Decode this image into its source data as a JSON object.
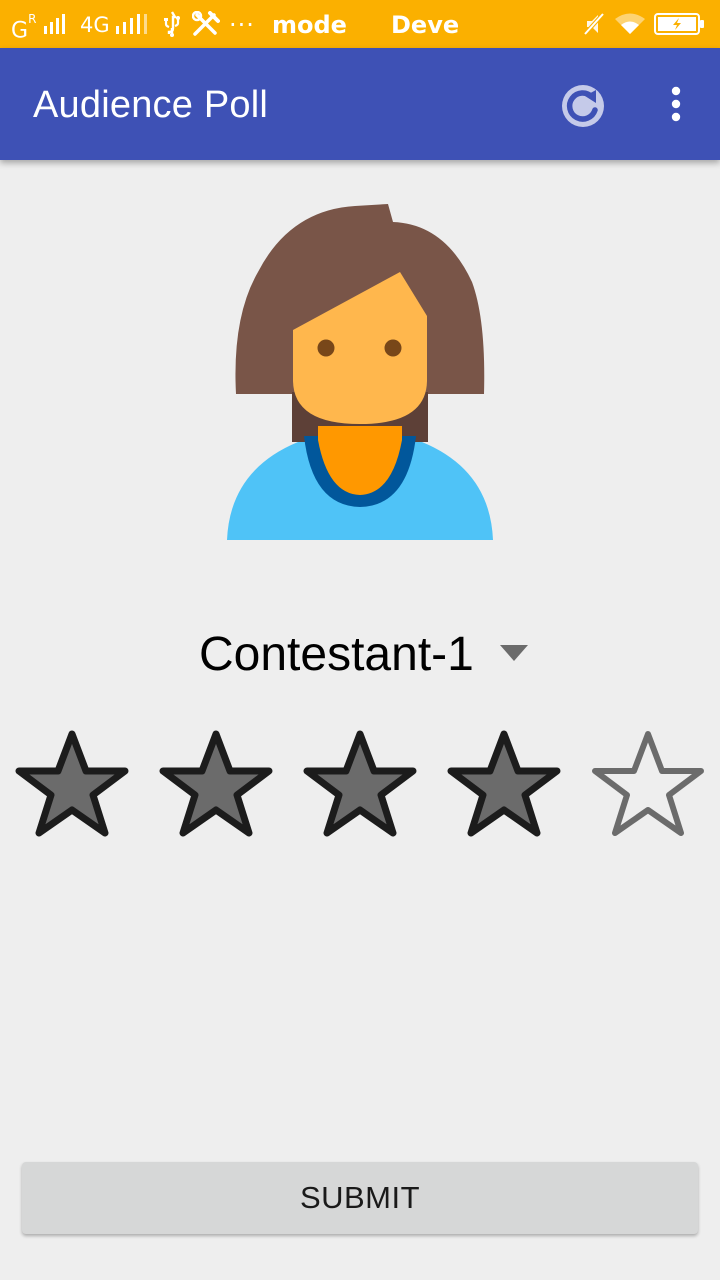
{
  "status_bar": {
    "carrier_left": "G",
    "carrier_sup": "R",
    "network": "4G",
    "dots": "···",
    "text_mode": "mode",
    "text_deve": "Deve",
    "icons": [
      "signal-icon",
      "signal-icon",
      "usb-icon",
      "tools-icon",
      "more-notifications-icon",
      "mute-icon",
      "wifi-icon",
      "battery-charging-icon"
    ]
  },
  "app_bar": {
    "title": "Audience Poll",
    "actions": [
      {
        "icon": "refresh-icon"
      },
      {
        "icon": "overflow-menu-icon"
      }
    ],
    "background": "#3e51b5"
  },
  "avatar": {
    "icon": "woman-avatar-icon"
  },
  "spinner": {
    "selected": "Contestant-1",
    "icon": "dropdown-arrow-icon"
  },
  "rating": {
    "value": 4,
    "max": 5,
    "filled_color": "#6b6b6b",
    "empty_color": "#6b6b6b"
  },
  "submit": {
    "label": "SUBMIT"
  },
  "colors": {
    "status_bar": "#fbb000",
    "background": "#eeeeee",
    "button": "#d6d7d7"
  }
}
